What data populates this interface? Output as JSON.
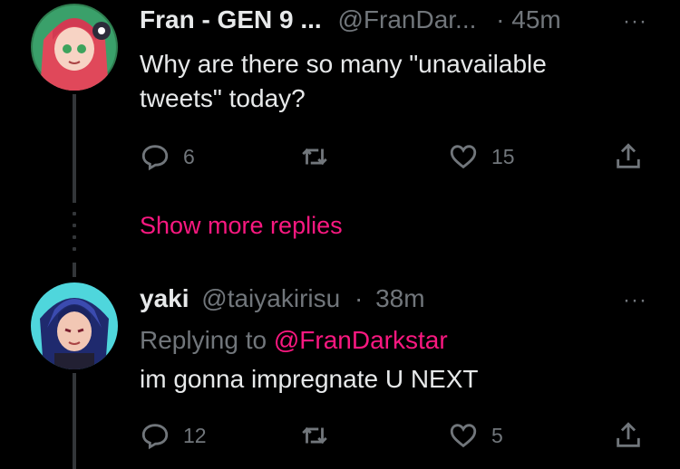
{
  "tweets": [
    {
      "name": "Fran - GEN 9 ...",
      "handle": "@FranDar...",
      "separator": "·",
      "time": "45m",
      "more": "···",
      "text_line1": "Why are there so many \"unavailable",
      "text_line2": "tweets\" today?",
      "reply_count": "6",
      "retweet_count": "",
      "like_count": "15"
    },
    {
      "name": "yaki",
      "handle": "@taiyakirisu",
      "separator": "·",
      "time": "38m",
      "more": "···",
      "replying_prefix": "Replying to",
      "replying_mention": "@FranDarkstar",
      "text_line1": "im gonna impregnate U NEXT",
      "reply_count": "12",
      "retweet_count": "",
      "like_count": "5"
    }
  ],
  "show_more_replies": "Show more replies",
  "icons": {
    "reply": "reply-icon",
    "retweet": "retweet-icon",
    "like": "heart-icon",
    "share": "share-icon",
    "more": "more-icon"
  },
  "colors": {
    "background": "#000000",
    "text": "#e7e9ea",
    "muted": "#71767b",
    "accent": "#f91880"
  }
}
